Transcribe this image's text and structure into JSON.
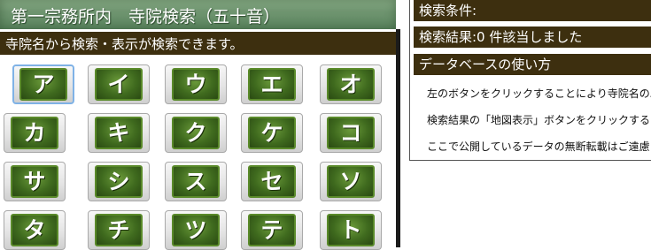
{
  "header": {
    "title": "第一宗務所内　寺院検索（五十音）"
  },
  "intro": {
    "text": "寺院名から検索・表示が検索できます。"
  },
  "kana_buttons": [
    "ア",
    "イ",
    "ウ",
    "エ",
    "オ",
    "カ",
    "キ",
    "ク",
    "ケ",
    "コ",
    "サ",
    "シ",
    "ス",
    "セ",
    "ソ",
    "タ",
    "チ",
    "ツ",
    "テ",
    "ト"
  ],
  "selected_button": "ア",
  "right_panel": {
    "conditions_label": "検索条件:",
    "results_label": "検索結果:0 件該当しました",
    "howto_label": "データベースの使い方",
    "help_lines": [
      "左のボタンをクリックすることにより寺院名のふ",
      "検索結果の「地図表示」ボタンをクリックすると",
      "ここで公開しているデータの無断転載はご遠慮"
    ]
  },
  "colors": {
    "bar_dark": "#3d2f0f",
    "kana_green": "#3f6a1e",
    "selected_border": "#7fb2e6"
  }
}
